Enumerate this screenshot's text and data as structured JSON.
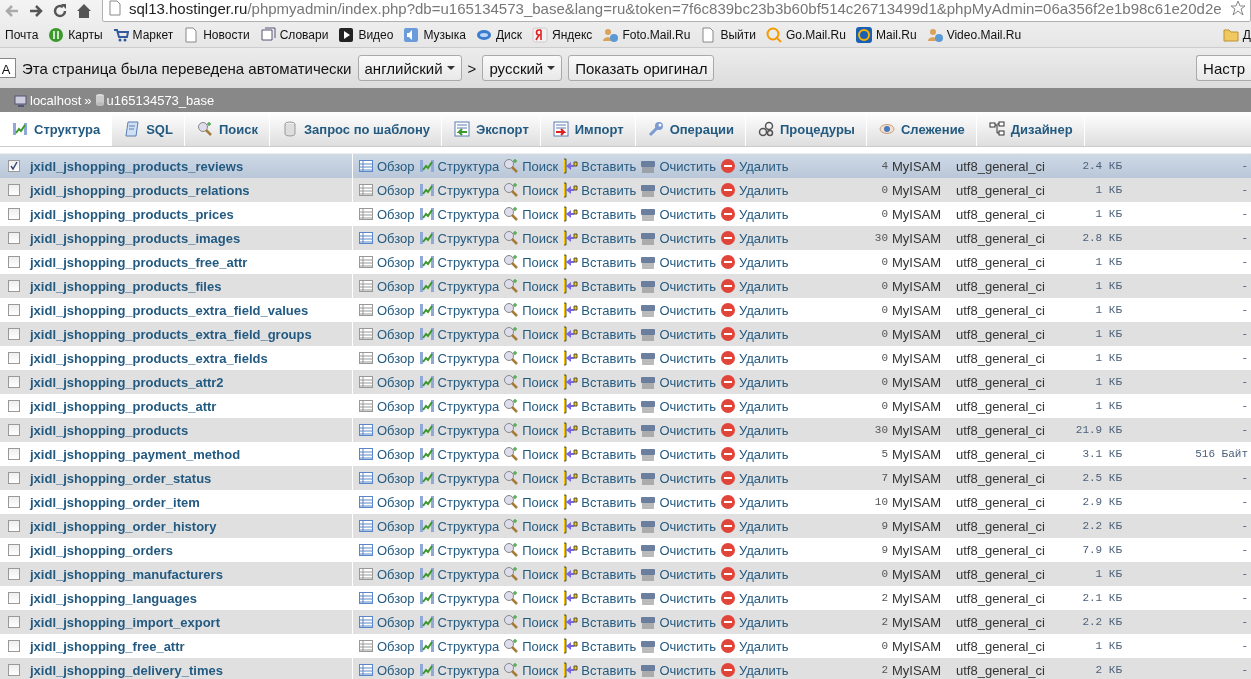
{
  "browser": {
    "url_host": "sql13.hostinger.ru",
    "url_path": "/phpmyadmin/index.php?db=u165134573_base&lang=ru&token=7f6c839bc23b3b60bf514c26713499d1&phpMyAdmin=06a356f2e1b98c61e20d2e",
    "bookmarks": [
      {
        "label": "Почта"
      },
      {
        "label": "Карты"
      },
      {
        "label": "Маркет"
      },
      {
        "label": "Новости"
      },
      {
        "label": "Словари"
      },
      {
        "label": "Видео"
      },
      {
        "label": "Музыка"
      },
      {
        "label": "Диск"
      },
      {
        "label": "Яндекс"
      },
      {
        "label": "Foto.Mail.Ru"
      },
      {
        "label": "Выйти"
      },
      {
        "label": "Go.Mail.Ru"
      },
      {
        "label": "Mail.Ru"
      },
      {
        "label": "Video.Mail.Ru"
      },
      {
        "label": "Д"
      }
    ]
  },
  "translate_bar": {
    "badge": "A",
    "message": "Эта страница была переведена автоматически",
    "from_language": "английский",
    "separator": ">",
    "to_language": "русский",
    "show_original": "Показать оригинал",
    "options": "Настр"
  },
  "breadcrumb": {
    "server": "localhost",
    "separator": "»",
    "database": "u165134573_base"
  },
  "tabs": [
    {
      "label": "Структура",
      "selected": true
    },
    {
      "label": "SQL",
      "selected": false
    },
    {
      "label": "Поиск",
      "selected": false
    },
    {
      "label": "Запрос по шаблону",
      "selected": false
    },
    {
      "label": "Экспорт",
      "selected": false
    },
    {
      "label": "Импорт",
      "selected": false
    },
    {
      "label": "Операции",
      "selected": false
    },
    {
      "label": "Процедуры",
      "selected": false
    },
    {
      "label": "Слежение",
      "selected": false
    },
    {
      "label": "Дизайнер",
      "selected": false
    }
  ],
  "tables": [
    {
      "name": "jxidl_jshopping_products_reviews",
      "checked": true,
      "actions": [
        "Обзор",
        "Структура",
        "Поиск",
        "Вставить",
        "Очистить",
        "Удалить"
      ],
      "rows": "4",
      "engine": "MyISAM",
      "collation": "utf8_general_ci",
      "size": "2.4 КБ",
      "overhead": "-"
    },
    {
      "name": "jxidl_jshopping_products_relations",
      "checked": false,
      "actions": [
        "Обзор",
        "Структура",
        "Поиск",
        "Вставить",
        "Очистить",
        "Удалить"
      ],
      "rows": "0",
      "engine": "MyISAM",
      "collation": "utf8_general_ci",
      "size": "1 КБ",
      "overhead": "-"
    },
    {
      "name": "jxidl_jshopping_products_prices",
      "checked": false,
      "actions": [
        "Обзор",
        "Структура",
        "Поиск",
        "Вставить",
        "Очистить",
        "Удалить"
      ],
      "rows": "0",
      "engine": "MyISAM",
      "collation": "utf8_general_ci",
      "size": "1 КБ",
      "overhead": "-"
    },
    {
      "name": "jxidl_jshopping_products_images",
      "checked": false,
      "actions": [
        "Обзор",
        "Структура",
        "Поиск",
        "Вставить",
        "Очистить",
        "Удалить"
      ],
      "rows": "30",
      "engine": "MyISAM",
      "collation": "utf8_general_ci",
      "size": "2.8 КБ",
      "overhead": "-"
    },
    {
      "name": "jxidl_jshopping_products_free_attr",
      "checked": false,
      "actions": [
        "Обзор",
        "Структура",
        "Поиск",
        "Вставить",
        "Очистить",
        "Удалить"
      ],
      "rows": "0",
      "engine": "MyISAM",
      "collation": "utf8_general_ci",
      "size": "1 КБ",
      "overhead": "-"
    },
    {
      "name": "jxidl_jshopping_products_files",
      "checked": false,
      "actions": [
        "Обзор",
        "Структура",
        "Поиск",
        "Вставить",
        "Очистить",
        "Удалить"
      ],
      "rows": "0",
      "engine": "MyISAM",
      "collation": "utf8_general_ci",
      "size": "1 КБ",
      "overhead": "-"
    },
    {
      "name": "jxidl_jshopping_products_extra_field_values",
      "checked": false,
      "actions": [
        "Обзор",
        "Структура",
        "Поиск",
        "Вставить",
        "Очистить",
        "Удалить"
      ],
      "rows": "0",
      "engine": "MyISAM",
      "collation": "utf8_general_ci",
      "size": "1 КБ",
      "overhead": "-"
    },
    {
      "name": "jxidl_jshopping_products_extra_field_groups",
      "checked": false,
      "actions": [
        "Обзор",
        "Структура",
        "Поиск",
        "Вставить",
        "Очистить",
        "Удалить"
      ],
      "rows": "0",
      "engine": "MyISAM",
      "collation": "utf8_general_ci",
      "size": "1 КБ",
      "overhead": "-"
    },
    {
      "name": "jxidl_jshopping_products_extra_fields",
      "checked": false,
      "actions": [
        "Обзор",
        "Структура",
        "Поиск",
        "Вставить",
        "Очистить",
        "Удалить"
      ],
      "rows": "0",
      "engine": "MyISAM",
      "collation": "utf8_general_ci",
      "size": "1 КБ",
      "overhead": "-"
    },
    {
      "name": "jxidl_jshopping_products_attr2",
      "checked": false,
      "actions": [
        "Обзор",
        "Структура",
        "Поиск",
        "Вставить",
        "Очистить",
        "Удалить"
      ],
      "rows": "0",
      "engine": "MyISAM",
      "collation": "utf8_general_ci",
      "size": "1 КБ",
      "overhead": "-"
    },
    {
      "name": "jxidl_jshopping_products_attr",
      "checked": false,
      "actions": [
        "Обзор",
        "Структура",
        "Поиск",
        "Вставить",
        "Очистить",
        "Удалить"
      ],
      "rows": "0",
      "engine": "MyISAM",
      "collation": "utf8_general_ci",
      "size": "1 КБ",
      "overhead": "-"
    },
    {
      "name": "jxidl_jshopping_products",
      "checked": false,
      "actions": [
        "Обзор",
        "Структура",
        "Поиск",
        "Вставить",
        "Очистить",
        "Удалить"
      ],
      "rows": "30",
      "engine": "MyISAM",
      "collation": "utf8_general_ci",
      "size": "21.9 КБ",
      "overhead": "-"
    },
    {
      "name": "jxidl_jshopping_payment_method",
      "checked": false,
      "actions": [
        "Обзор",
        "Структура",
        "Поиск",
        "Вставить",
        "Очистить",
        "Удалить"
      ],
      "rows": "5",
      "engine": "MyISAM",
      "collation": "utf8_general_ci",
      "size": "3.1 КБ",
      "overhead": "516 Байт"
    },
    {
      "name": "jxidl_jshopping_order_status",
      "checked": false,
      "actions": [
        "Обзор",
        "Структура",
        "Поиск",
        "Вставить",
        "Очистить",
        "Удалить"
      ],
      "rows": "7",
      "engine": "MyISAM",
      "collation": "utf8_general_ci",
      "size": "2.5 КБ",
      "overhead": "-"
    },
    {
      "name": "jxidl_jshopping_order_item",
      "checked": false,
      "actions": [
        "Обзор",
        "Структура",
        "Поиск",
        "Вставить",
        "Очистить",
        "Удалить"
      ],
      "rows": "10",
      "engine": "MyISAM",
      "collation": "utf8_general_ci",
      "size": "2.9 КБ",
      "overhead": "-"
    },
    {
      "name": "jxidl_jshopping_order_history",
      "checked": false,
      "actions": [
        "Обзор",
        "Структура",
        "Поиск",
        "Вставить",
        "Очистить",
        "Удалить"
      ],
      "rows": "9",
      "engine": "MyISAM",
      "collation": "utf8_general_ci",
      "size": "2.2 КБ",
      "overhead": "-"
    },
    {
      "name": "jxidl_jshopping_orders",
      "checked": false,
      "actions": [
        "Обзор",
        "Структура",
        "Поиск",
        "Вставить",
        "Очистить",
        "Удалить"
      ],
      "rows": "9",
      "engine": "MyISAM",
      "collation": "utf8_general_ci",
      "size": "7.9 КБ",
      "overhead": "-"
    },
    {
      "name": "jxidl_jshopping_manufacturers",
      "checked": false,
      "actions": [
        "Обзор",
        "Структура",
        "Поиск",
        "Вставить",
        "Очистить",
        "Удалить"
      ],
      "rows": "0",
      "engine": "MyISAM",
      "collation": "utf8_general_ci",
      "size": "1 КБ",
      "overhead": "-"
    },
    {
      "name": "jxidl_jshopping_languages",
      "checked": false,
      "actions": [
        "Обзор",
        "Структура",
        "Поиск",
        "Вставить",
        "Очистить",
        "Удалить"
      ],
      "rows": "2",
      "engine": "MyISAM",
      "collation": "utf8_general_ci",
      "size": "2.1 КБ",
      "overhead": "-"
    },
    {
      "name": "jxidl_jshopping_import_export",
      "checked": false,
      "actions": [
        "Обзор",
        "Структура",
        "Поиск",
        "Вставить",
        "Очистить",
        "Удалить"
      ],
      "rows": "2",
      "engine": "MyISAM",
      "collation": "utf8_general_ci",
      "size": "2.2 КБ",
      "overhead": "-"
    },
    {
      "name": "jxidl_jshopping_free_attr",
      "checked": false,
      "actions": [
        "Обзор",
        "Структура",
        "Поиск",
        "Вставить",
        "Очистить",
        "Удалить"
      ],
      "rows": "0",
      "engine": "MyISAM",
      "collation": "utf8_general_ci",
      "size": "1 КБ",
      "overhead": "-"
    },
    {
      "name": "jxidl_jshopping_delivery_times",
      "checked": false,
      "actions": [
        "Обзор",
        "Структура",
        "Поиск",
        "Вставить",
        "Очистить",
        "Удалить"
      ],
      "rows": "2",
      "engine": "MyISAM",
      "collation": "utf8_general_ci",
      "size": "2 КБ",
      "overhead": "-"
    }
  ]
}
